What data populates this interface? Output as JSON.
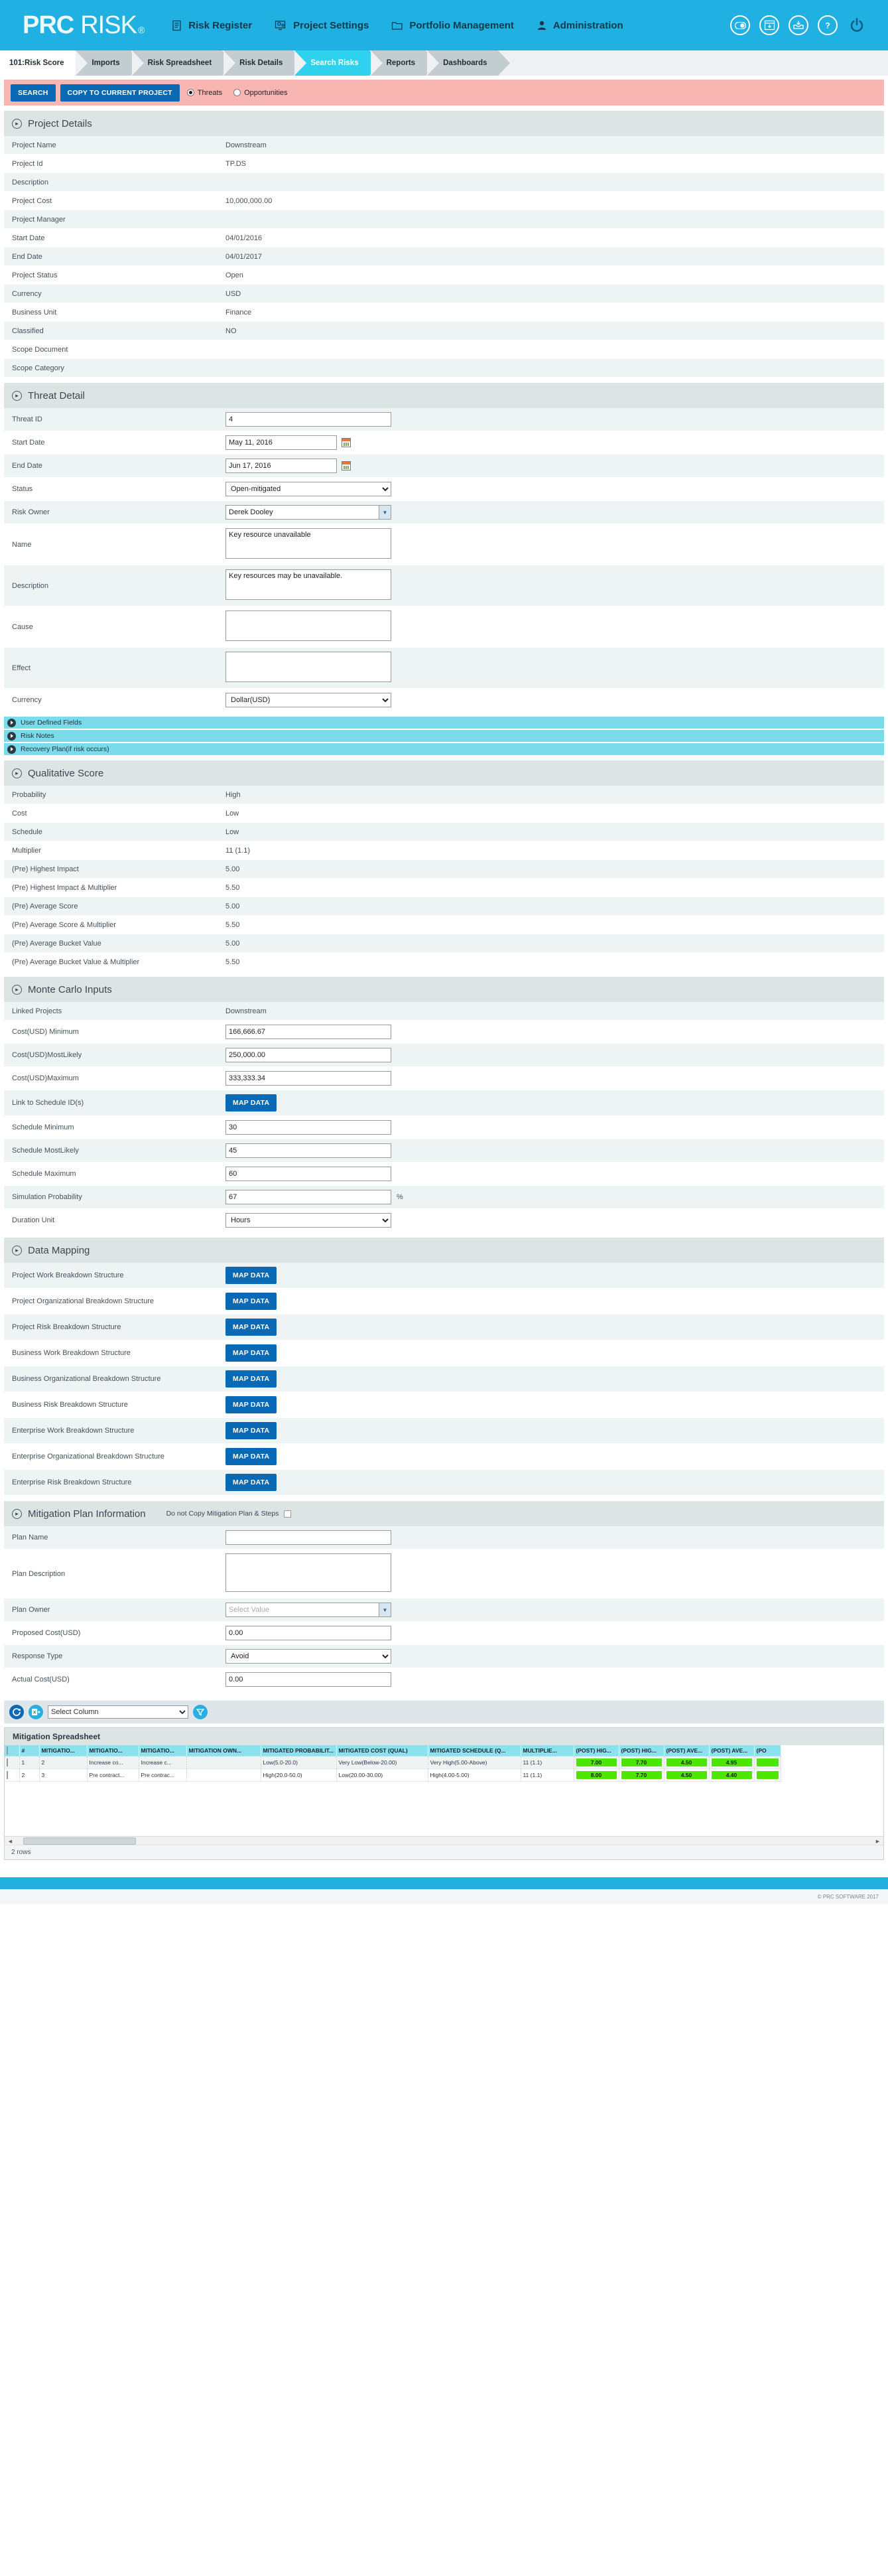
{
  "brand": {
    "part1": "PRC",
    "part2": "RISK",
    "registered": "®"
  },
  "topnav": {
    "items": [
      {
        "label": "Risk Register",
        "icon": "document-icon"
      },
      {
        "label": "Project Settings",
        "icon": "settings-gear-icon"
      },
      {
        "label": "Portfolio Management",
        "icon": "folder-icon"
      },
      {
        "label": "Administration",
        "icon": "user-icon"
      }
    ],
    "icons": [
      {
        "name": "toggle-icon"
      },
      {
        "name": "download-window-icon"
      },
      {
        "name": "inbox-download-icon"
      },
      {
        "name": "help-icon"
      },
      {
        "name": "power-icon"
      }
    ]
  },
  "tabs": [
    {
      "label": "101:Risk Score",
      "state": "active-white"
    },
    {
      "label": "Imports",
      "state": ""
    },
    {
      "label": "Risk Spreadsheet",
      "state": ""
    },
    {
      "label": "Risk Details",
      "state": ""
    },
    {
      "label": "Search Risks",
      "state": "active-cyan"
    },
    {
      "label": "Reports",
      "state": ""
    },
    {
      "label": "Dashboards",
      "state": ""
    }
  ],
  "actionbar": {
    "search_label": "SEARCH",
    "copy_label": "COPY TO CURRENT PROJECT",
    "threats_label": "Threats",
    "opportunities_label": "Opportunities",
    "selected": "Threats"
  },
  "project_details": {
    "title": "Project Details",
    "rows": [
      {
        "label": "Project Name",
        "value": "Downstream"
      },
      {
        "label": "Project Id",
        "value": "TP.DS"
      },
      {
        "label": "Description",
        "value": ""
      },
      {
        "label": "Project Cost",
        "value": "10,000,000.00"
      },
      {
        "label": "Project Manager",
        "value": ""
      },
      {
        "label": "Start Date",
        "value": "04/01/2016"
      },
      {
        "label": "End Date",
        "value": "04/01/2017"
      },
      {
        "label": "Project Status",
        "value": "Open"
      },
      {
        "label": "Currency",
        "value": "USD"
      },
      {
        "label": "Business Unit",
        "value": "Finance"
      },
      {
        "label": "Classified",
        "value": "NO"
      },
      {
        "label": "Scope Document",
        "value": ""
      },
      {
        "label": "Scope Category",
        "value": ""
      }
    ]
  },
  "threat_detail": {
    "title": "Threat Detail",
    "threat_id_label": "Threat ID",
    "threat_id_value": "4",
    "start_date_label": "Start Date",
    "start_date_value": "May 11, 2016",
    "end_date_label": "End Date",
    "end_date_value": "Jun 17, 2016",
    "status_label": "Status",
    "status_value": "Open-mitigated",
    "risk_owner_label": "Risk Owner",
    "risk_owner_value": "Derek Dooley",
    "name_label": "Name",
    "name_value": "Key resource unavailable",
    "description_label": "Description",
    "description_value": "Key resources may be unavailable.",
    "cause_label": "Cause",
    "cause_value": "",
    "effect_label": "Effect",
    "effect_value": "",
    "currency_label": "Currency",
    "currency_value": "Dollar(USD)"
  },
  "accordions": [
    {
      "label": "User Defined Fields"
    },
    {
      "label": "Risk Notes"
    },
    {
      "label": "Recovery Plan(if risk occurs)"
    }
  ],
  "qualitative_score": {
    "title": "Qualitative Score",
    "rows": [
      {
        "label": "Probability",
        "value": "High"
      },
      {
        "label": "Cost",
        "value": "Low"
      },
      {
        "label": "Schedule",
        "value": "Low"
      },
      {
        "label": "Multiplier",
        "value": "11 (1.1)"
      },
      {
        "label": "(Pre) Highest Impact",
        "value": "5.00"
      },
      {
        "label": "(Pre) Highest Impact & Multiplier",
        "value": "5.50"
      },
      {
        "label": "(Pre) Average Score",
        "value": "5.00"
      },
      {
        "label": "(Pre) Average Score & Multiplier",
        "value": "5.50"
      },
      {
        "label": "(Pre) Average Bucket Value",
        "value": "5.00"
      },
      {
        "label": "(Pre) Average Bucket Value & Multiplier",
        "value": "5.50"
      }
    ]
  },
  "monte_carlo": {
    "title": "Monte Carlo Inputs",
    "linked_projects_label": "Linked Projects",
    "linked_projects_value": "Downstream",
    "cost_min_label": "Cost(USD) Minimum",
    "cost_min_value": "166,666.67",
    "cost_ml_label": "Cost(USD)MostLikely",
    "cost_ml_value": "250,000.00",
    "cost_max_label": "Cost(USD)Maximum",
    "cost_max_value": "333,333.34",
    "link_schedule_label": "Link to Schedule ID(s)",
    "map_data_label": "MAP DATA",
    "sched_min_label": "Schedule Minimum",
    "sched_min_value": "30",
    "sched_ml_label": "Schedule MostLikely",
    "sched_ml_value": "45",
    "sched_max_label": "Schedule Maximum",
    "sched_max_value": "60",
    "sim_prob_label": "Simulation Probability",
    "sim_prob_value": "67",
    "sim_prob_unit": "%",
    "duration_unit_label": "Duration Unit",
    "duration_unit_value": "Hours"
  },
  "data_mapping": {
    "title": "Data Mapping",
    "button_label": "MAP DATA",
    "rows": [
      {
        "label": "Project Work Breakdown Structure"
      },
      {
        "label": "Project Organizational Breakdown Structure"
      },
      {
        "label": "Project Risk Breakdown Structure"
      },
      {
        "label": "Business Work Breakdown Structure"
      },
      {
        "label": "Business Organizational Breakdown Structure"
      },
      {
        "label": "Business Risk Breakdown Structure"
      },
      {
        "label": "Enterprise Work Breakdown Structure"
      },
      {
        "label": "Enterprise Organizational Breakdown Structure"
      },
      {
        "label": "Enterprise Risk Breakdown Structure"
      }
    ]
  },
  "mitigation_plan": {
    "title": "Mitigation Plan Information",
    "do_not_copy_label": "Do not Copy Mitigation Plan & Steps",
    "plan_name_label": "Plan Name",
    "plan_name_value": "",
    "plan_desc_label": "Plan Description",
    "plan_desc_value": "",
    "plan_owner_label": "Plan Owner",
    "plan_owner_placeholder": "Select Value",
    "proposed_cost_label": "Proposed Cost(USD)",
    "proposed_cost_value": "0.00",
    "response_type_label": "Response Type",
    "response_type_value": "Avoid",
    "actual_cost_label": "Actual Cost(USD)",
    "actual_cost_value": "0.00"
  },
  "gridbar": {
    "refresh_icon": "refresh-icon",
    "excel_icon": "excel-export-icon",
    "filter_icon": "filter-icon",
    "select_column_value": "Select Column"
  },
  "spreadsheet": {
    "title": "Mitigation Spreadsheet",
    "columns": [
      {
        "label": "",
        "width": 22
      },
      {
        "label": "#",
        "width": 30
      },
      {
        "label": "MITIGATIO...",
        "width": 72
      },
      {
        "label": "MITIGATIO...",
        "width": 78
      },
      {
        "label": "MITIGATIO...",
        "width": 72
      },
      {
        "label": "MITIGATION OWN...",
        "width": 112
      },
      {
        "label": "MITIGATED PROBABILIT...",
        "width": 114
      },
      {
        "label": "MITIGATED COST (QUAL)",
        "width": 138
      },
      {
        "label": "MITIGATED SCHEDULE (Q...",
        "width": 140
      },
      {
        "label": "MULTIPLIE...",
        "width": 80
      },
      {
        "label": "(POST) HIG...",
        "width": 68
      },
      {
        "label": "(POST) HIG...",
        "width": 68
      },
      {
        "label": "(POST) AVE...",
        "width": 68
      },
      {
        "label": "(POST) AVE...",
        "width": 68
      },
      {
        "label": "(PO",
        "width": 40
      }
    ],
    "rows": [
      {
        "checked": false,
        "cells": [
          "",
          "1",
          "2",
          "Increase co...",
          "Increase c...",
          "",
          "Low(5.0-20.0)",
          "Very Low(Below-20.00)",
          "Very High(5.00-Above)",
          "11 (1.1)",
          "7.00",
          "7.70",
          "4.50",
          "4.95",
          ""
        ],
        "scores": {
          "10": "#4ce600",
          "11": "#4ce600",
          "12": "#4ce600",
          "13": "#4ce600"
        }
      },
      {
        "checked": false,
        "cells": [
          "",
          "2",
          "3",
          "Pre contract...",
          "Pre contrac...",
          "",
          "High(20.0-50.0)",
          "Low(20.00-30.00)",
          "High(4.00-5.00)",
          "11 (1.1)",
          "8.00",
          "7.70",
          "4.50",
          "4.40",
          ""
        ],
        "scores": {
          "10": "#4ce600",
          "11": "#4ce600",
          "12": "#4ce600",
          "13": "#4ce600"
        }
      }
    ],
    "footer_text": "2 rows"
  },
  "footer": {
    "copyright": "© PRC SOFTWARE 2017"
  },
  "colors": {
    "brand_blue": "#21b0e2",
    "action_pink": "#f8b6b3",
    "button_blue": "#0a69b5",
    "accordion_cyan": "#7cdbea",
    "section_grey": "#dde5e4",
    "grid_header_cyan": "#8ce1ef",
    "score_green": "#4ce600"
  }
}
